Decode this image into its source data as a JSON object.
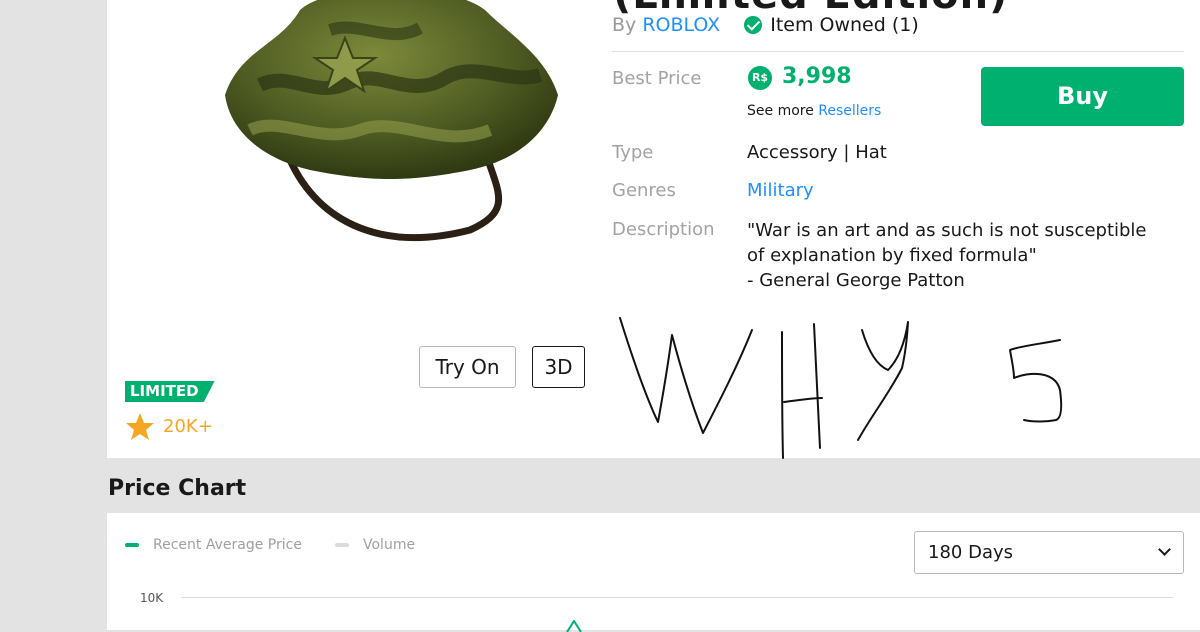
{
  "item": {
    "title_fragment": "(Limited Edition)",
    "by_label": "By",
    "creator": "ROBLOX",
    "owned_label": "Item Owned (1)"
  },
  "pricing": {
    "best_price_label": "Best Price",
    "currency_symbol": "R$",
    "best_price": "3,998",
    "see_more_label": "See more",
    "resellers_link": "Resellers",
    "buy_label": "Buy"
  },
  "details": {
    "type_label": "Type",
    "type_value": "Accessory | Hat",
    "genres_label": "Genres",
    "genres_value": "Military",
    "description_label": "Description",
    "description_value": "\"War is an art and as such is not susceptible\nof explanation by fixed formula\"\n- General George Patton"
  },
  "preview": {
    "try_on_label": "Try On",
    "three_d_label": "3D"
  },
  "badges": {
    "limited_label": "LIMITED",
    "favorites_count": "20K+"
  },
  "price_chart": {
    "heading": "Price Chart",
    "legend": [
      "Recent Average Price",
      "Volume"
    ],
    "period_selected": "180 Days"
  },
  "chart_data": {
    "type": "line",
    "title": "",
    "series": [
      {
        "name": "Recent Average Price",
        "values": []
      },
      {
        "name": "Volume",
        "values": []
      }
    ],
    "y_tick_labels": [
      "10K"
    ],
    "xlabel": "",
    "ylabel": ""
  },
  "colors": {
    "accent_green": "#00b06f",
    "link_blue": "#1e90ff",
    "favorite_gold": "#f5a623"
  }
}
